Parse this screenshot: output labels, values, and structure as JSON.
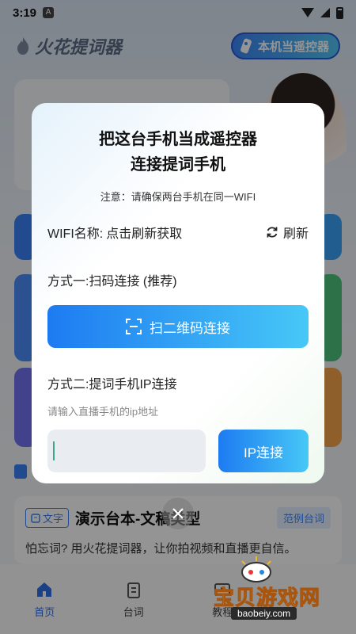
{
  "status_bar": {
    "time": "3:19",
    "a_icon": "A"
  },
  "app": {
    "name": "火花提词器",
    "remote_button": "本机当遥控器",
    "card": {
      "tag": "文字",
      "title": "演示台本-文稿类型",
      "sample_tag": "范例台词",
      "desc": "怕忘词? 用火花提词器，让你拍视频和直播更自信。"
    },
    "nav": [
      {
        "label": "首页",
        "icon": "home-icon"
      },
      {
        "label": "台词",
        "icon": "clipboard-icon"
      },
      {
        "label": "教程",
        "icon": "video-icon"
      }
    ]
  },
  "dialog": {
    "title_line1": "把这台手机当成遥控器",
    "title_line2": "连接提词手机",
    "note": "注意：请确保两台手机在同一WIFI",
    "wifi_label": "WIFI名称:",
    "wifi_value": "点击刷新获取",
    "refresh_label": "刷新",
    "method1_label": "方式一:扫码连接 (推荐)",
    "scan_button": "扫二维码连接",
    "method2_label": "方式二:提词手机IP连接",
    "ip_hint": "请输入直播手机的ip地址",
    "ip_value": "",
    "ip_button": "IP连接"
  },
  "watermark": {
    "text": "宝贝游戏网",
    "url": "baobeiy.com"
  },
  "colors": {
    "primary": "#1d7bf1",
    "accent": "#47c8f7",
    "overlay": "rgba(0,0,0,0.42)"
  }
}
